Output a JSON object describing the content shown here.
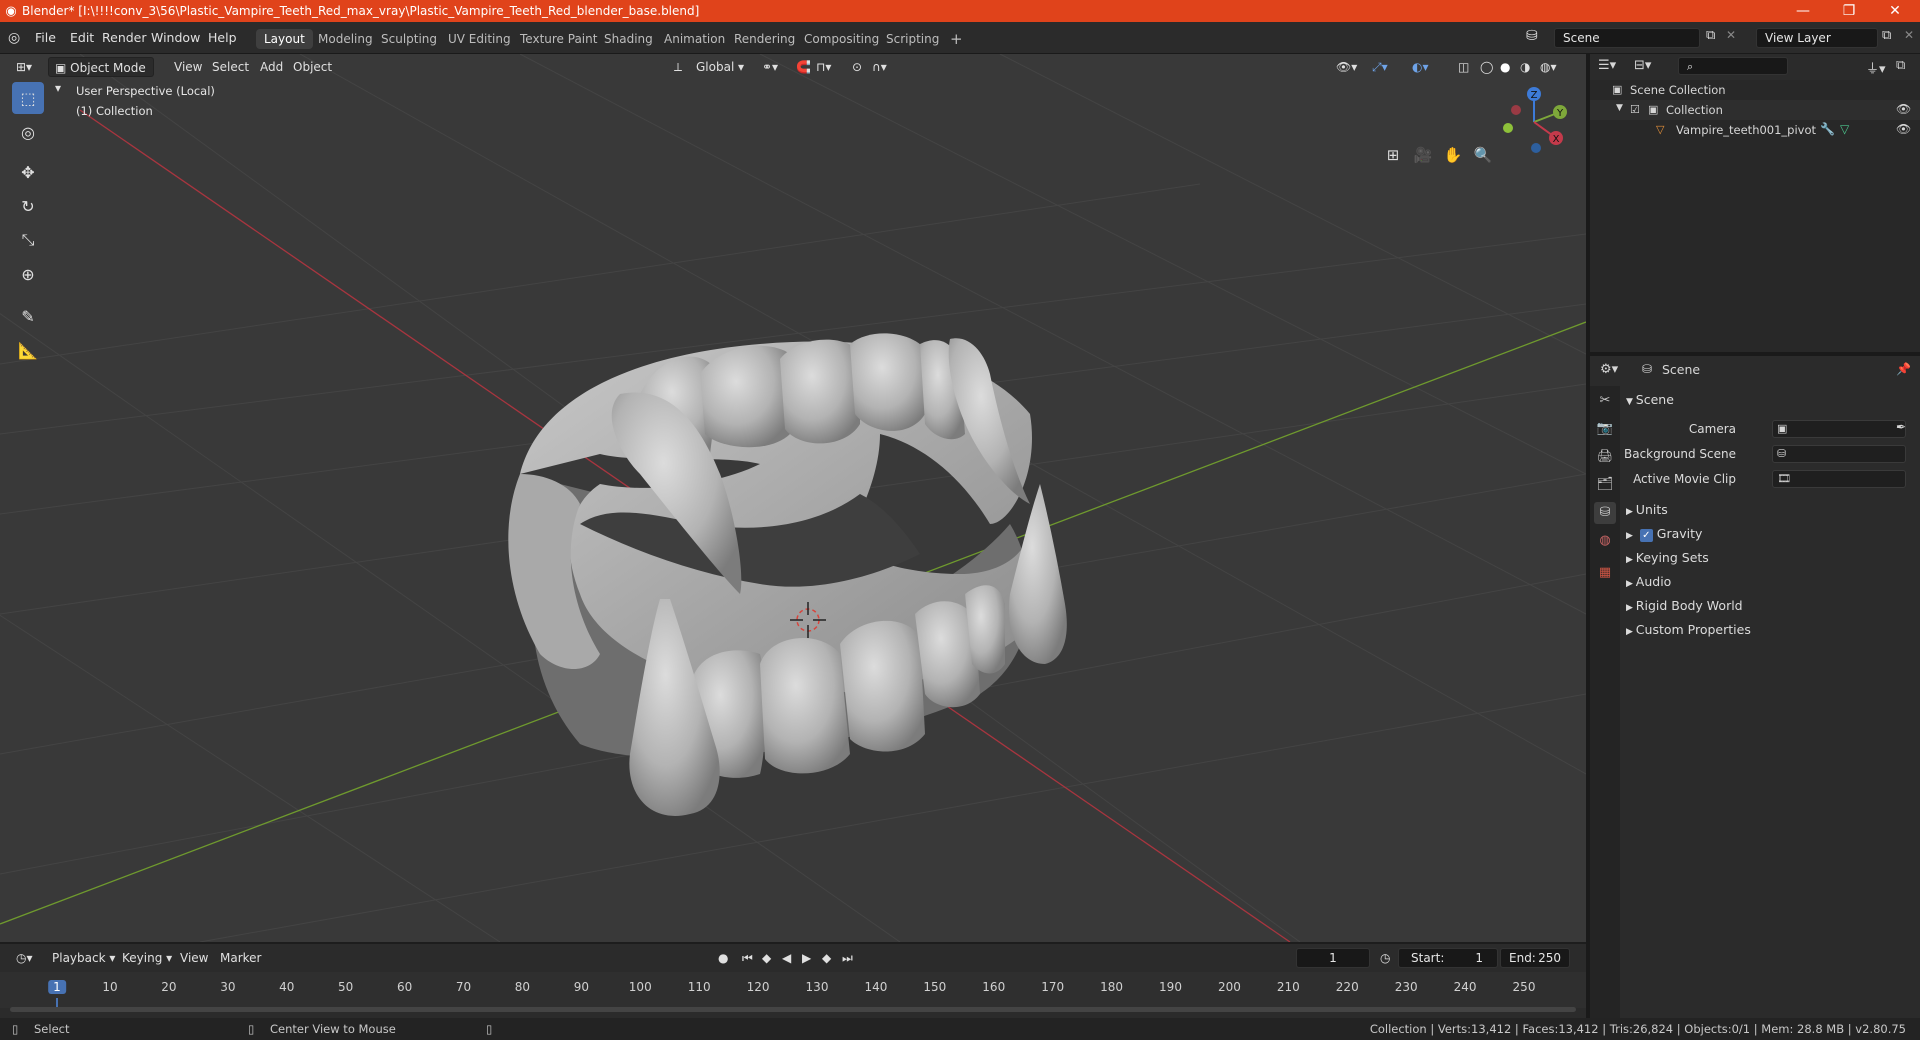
{
  "window": {
    "title": "Blender* [I:\\!!!!conv_3\\56\\Plastic_Vampire_Teeth_Red_max_vray\\Plastic_Vampire_Teeth_Red_blender_base.blend]",
    "minimize": "—",
    "maximize": "❐",
    "close": "✕"
  },
  "menu": [
    "File",
    "Edit",
    "Render",
    "Window",
    "Help"
  ],
  "workspaces": [
    "Layout",
    "Modeling",
    "Sculpting",
    "UV Editing",
    "Texture Paint",
    "Shading",
    "Animation",
    "Rendering",
    "Compositing",
    "Scripting"
  ],
  "workspace_add": "+",
  "scene_field": "Scene",
  "view_layer_field": "View Layer",
  "viewport": {
    "mode": "Object Mode",
    "menus": [
      "View",
      "Select",
      "Add",
      "Object"
    ],
    "transform_orientation": "Global",
    "overlay_text_1": "User Perspective (Local)",
    "overlay_text_2": "(1) Collection",
    "gizmo": {
      "x": "X",
      "y": "Y",
      "z": "Z"
    },
    "colors": {
      "x_axis": "#c43a4b",
      "y_axis": "#7ea83a",
      "z_axis": "#3d7bd8",
      "bg": "#393939",
      "grid": "#444444"
    }
  },
  "outliner": {
    "search_placeholder": "",
    "items": [
      {
        "label": "Scene Collection"
      },
      {
        "label": "Collection"
      },
      {
        "label": "Vampire_teeth001_pivot"
      }
    ]
  },
  "properties": {
    "header": "Scene",
    "panel_title": "Scene",
    "camera_label": "Camera",
    "background_scene_label": "Background Scene",
    "active_movie_clip_label": "Active Movie Clip",
    "sections": [
      "Units",
      "Gravity",
      "Keying Sets",
      "Audio",
      "Rigid Body World",
      "Custom Properties"
    ],
    "gravity_checked": true
  },
  "timeline": {
    "menus": [
      "Playback",
      "Keying",
      "View",
      "Marker"
    ],
    "current_frame": "1",
    "start_label": "Start:",
    "start_value": "1",
    "end_label": "End:",
    "end_value": "250",
    "ticks": [
      "1",
      "10",
      "20",
      "30",
      "40",
      "50",
      "60",
      "70",
      "80",
      "90",
      "100",
      "110",
      "120",
      "130",
      "140",
      "150",
      "160",
      "170",
      "180",
      "190",
      "200",
      "210",
      "220",
      "230",
      "240",
      "250"
    ]
  },
  "statusbar": {
    "left_action": "Select",
    "middle_action": "Center View to Mouse",
    "stats": "Collection | Verts:13,412 | Faces:13,412 | Tris:26,824 | Objects:0/1 | Mem: 28.8 MB | v2.80.75"
  }
}
